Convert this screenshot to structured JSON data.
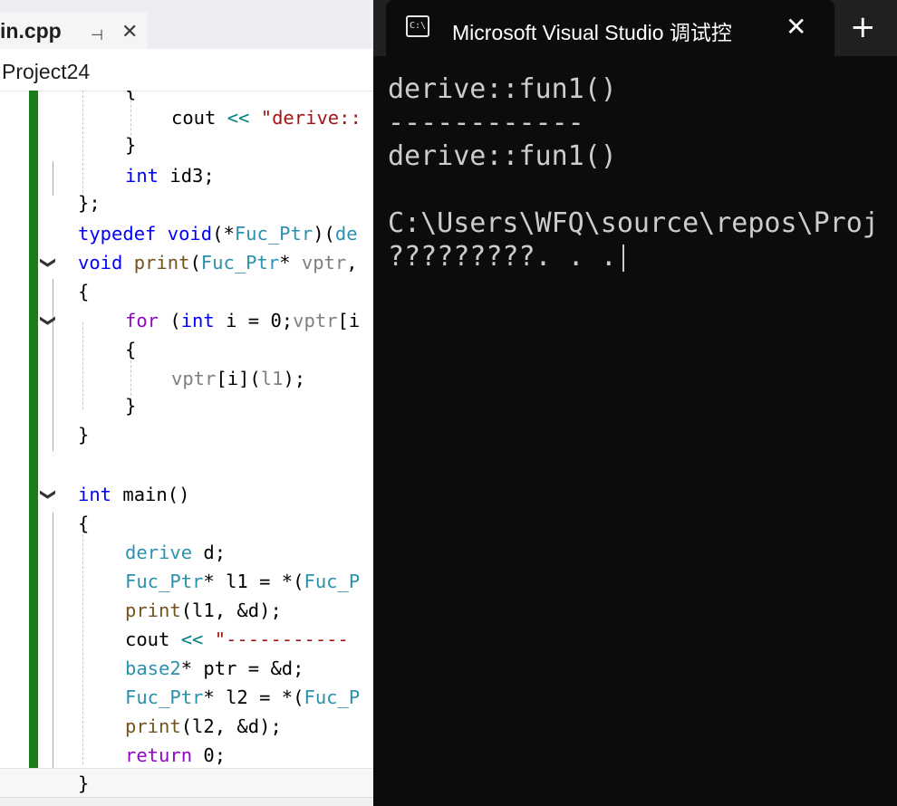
{
  "editor": {
    "tab": {
      "name": "in.cpp",
      "pin_icon": "pin-icon",
      "close_icon": "close-icon"
    },
    "project": "Project24",
    "code": {
      "l1": {
        "a": "cout ",
        "b": "<< ",
        "c": "\"derive::"
      },
      "l2": {
        "a": "}"
      },
      "l3": {
        "a": "int",
        "b": " id3;"
      },
      "l4": {
        "a": "};"
      },
      "l5": {
        "a": "typedef",
        "b": " ",
        "c": "void",
        "d": "(*",
        "e": "Fuc_Ptr",
        "f": ")(",
        "g": "de"
      },
      "l6": {
        "a": "void",
        "b": " ",
        "c": "print",
        "d": "(",
        "e": "Fuc_Ptr",
        "f": "* ",
        "g": "vptr",
        "h": ","
      },
      "l7": {
        "a": "{"
      },
      "l8": {
        "a": "for",
        "b": " (",
        "c": "int",
        "d": " i = 0;",
        "e": "vptr",
        "f": "[i"
      },
      "l9": {
        "a": "{"
      },
      "l10": {
        "a": "vptr",
        "b": "[i](",
        "c": "l1",
        "d": ");"
      },
      "l11": {
        "a": "}"
      },
      "l12": {
        "a": "}"
      },
      "l13": {
        "a": "int",
        "b": " main()"
      },
      "l14": {
        "a": "{"
      },
      "l15": {
        "a": "derive",
        "b": " d;"
      },
      "l16": {
        "a": "Fuc_Ptr",
        "b": "* l1 = *(",
        "c": "Fuc_P"
      },
      "l17": {
        "a": "print",
        "b": "(l1, &d);"
      },
      "l18": {
        "a": "cout ",
        "b": "<< ",
        "c": "\"-----------"
      },
      "l19": {
        "a": "base2",
        "b": "* ptr = &d;"
      },
      "l20": {
        "a": "Fuc_Ptr",
        "b": "* l2 = *(",
        "c": "Fuc_P"
      },
      "l21": {
        "a": "print",
        "b": "(l2, &d);"
      },
      "l22": {
        "a": "return",
        "b": " 0;"
      },
      "l23": {
        "a": "}"
      }
    }
  },
  "terminal": {
    "title": "Microsoft Visual Studio 调试控",
    "icon": "cmd-icon",
    "lines": [
      "derive::fun1()",
      "------------",
      "derive::fun1()",
      "",
      "C:\\Users\\WFQ\\source\\repos\\Proj",
      "?????????. . ."
    ]
  },
  "colors": {
    "keyword": "#0000ff",
    "type": "#2b91af",
    "string": "#a31515",
    "function": "#74531f",
    "param": "#808080",
    "terminal_bg": "#0c0c0c",
    "terminal_fg": "#cccccc",
    "change_bar": "#1a7d1a"
  }
}
